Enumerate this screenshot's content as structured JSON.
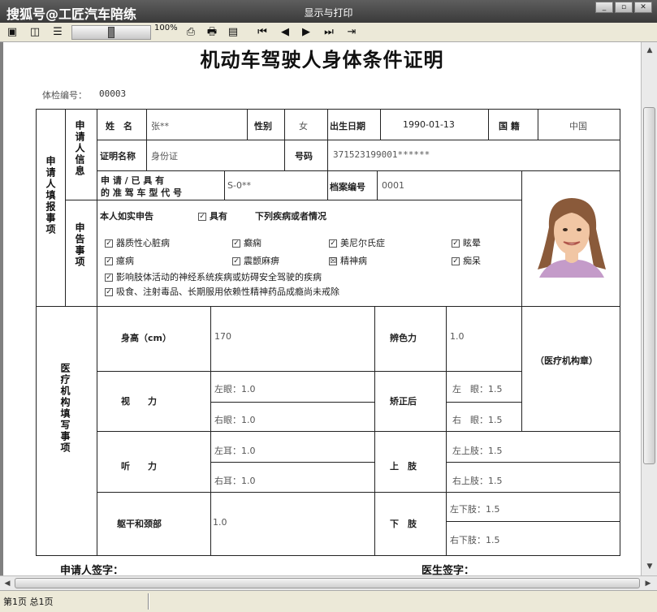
{
  "window": {
    "watermark": "搜狐号@工匠汽车陪练",
    "title": "显示与打印",
    "zoom": "100%",
    "zoom_level": 0.5
  },
  "document": {
    "title": "机动车驾驶人身体条件证明",
    "exam_no_label": "体检编号：",
    "exam_no": "00003",
    "applicant_section": "申请人填报事项",
    "info_section": "申请人信息",
    "declare_section": "申告事项",
    "medical_section": "医疗机构填写事项",
    "name_label": "姓　名",
    "name_value": "张**",
    "sex_label": "性别",
    "sex_value": "女",
    "dob_label": "出生日期",
    "dob_value": "1990-01-13",
    "nation_label": "国 籍",
    "nation_value": "中国",
    "idtype_label": "证明名称",
    "idtype_value": "身份证",
    "idno_label": "号码",
    "idno_value": "371523199001******",
    "license_label_1": "申 请 / 已 具 有",
    "license_label_2": "的 准 驾 车 型 代 号",
    "license_value": "S-0**",
    "file_label": "档案编号",
    "file_value": "0001",
    "declare_intro": "本人如实申告",
    "declare_have": "具有",
    "declare_tail": "下列疾病或者情况",
    "diseases": [
      {
        "label": "器质性心脏病",
        "mark": "✓"
      },
      {
        "label": "癫痫",
        "mark": "✓"
      },
      {
        "label": "美尼尔氏症",
        "mark": "✓"
      },
      {
        "label": "眩晕",
        "mark": "✓"
      },
      {
        "label": "癔病",
        "mark": "✓"
      },
      {
        "label": "震颤麻痹",
        "mark": "✓"
      },
      {
        "label": "精神病",
        "mark": "☒"
      },
      {
        "label": "痴呆",
        "mark": "✓"
      },
      {
        "label": "影响肢体活动的神经系统疾病或妨碍安全驾驶的疾病",
        "mark": "✓"
      },
      {
        "label": "吸食、注射毒品、长期服用依赖性精神药品成瘾尚未戒除",
        "mark": "✓"
      }
    ],
    "height_label": "身高（cm）",
    "height_value": "170",
    "color_label": "辨色力",
    "color_value": "1.0",
    "stamp_label": "（医疗机构章）",
    "vision_label": "视　　力",
    "vision_left": "左眼：1.0",
    "vision_right": "右眼：1.0",
    "corrected_label": "矫正后",
    "corrected_left": "左　眼：1.5",
    "corrected_right": "右　眼：1.5",
    "hearing_label": "听　　力",
    "hearing_left": "左耳：1.0",
    "hearing_right": "右耳：1.0",
    "upper_label": "上　肢",
    "upper_left": "左上肢：1.5",
    "upper_right": "右上肢：1.5",
    "torso_label": "躯干和颈部",
    "torso_value": "1.0",
    "lower_label": "下　肢",
    "lower_left": "左下肢：1.5",
    "lower_right": "右下肢：1.5",
    "applicant_sign": "申请人签字：",
    "doctor_sign": "医生签字："
  },
  "status": {
    "page_info": "第1页 总1页"
  }
}
